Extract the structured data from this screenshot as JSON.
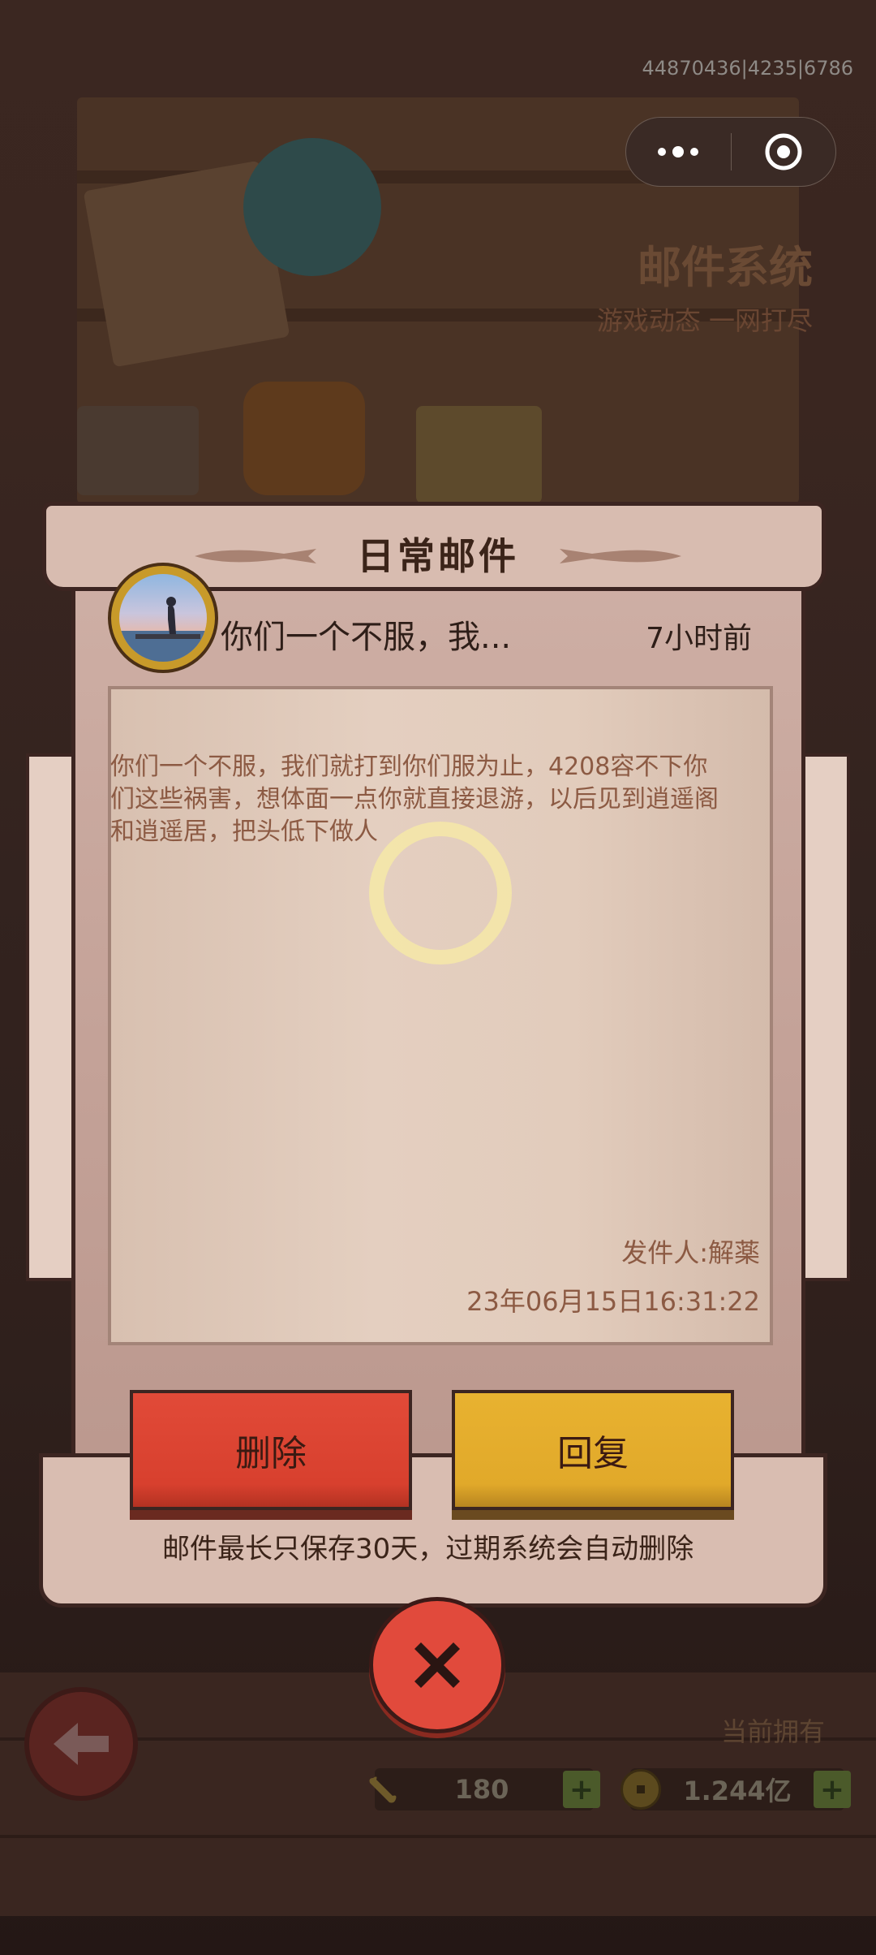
{
  "status": {
    "debug_id": "44870436|4235|6786"
  },
  "capsule": {
    "more_icon": "more-dots-icon",
    "close_icon": "target-circle-icon"
  },
  "background": {
    "title": "邮件系统",
    "subtitle": "游戏动态 一网打尽",
    "owned_label": "当前拥有",
    "resource_1": "180",
    "resource_2": "1.244亿"
  },
  "mail": {
    "title": "日常邮件",
    "subject": "你们一个不服，我...",
    "time_ago": "7小时前",
    "content_lines": [
      "你们一个不服，我们就打到你们服为止，4208容不下你",
      "们这些祸害，想体面一点你就直接退游，以后见到逍遥阁",
      "和逍遥居，把头低下做人"
    ],
    "sender": "发件人:解薬",
    "date": "23年06月15日16:31:22"
  },
  "buttons": {
    "delete": "删除",
    "reply": "回复"
  },
  "notice": "邮件最长只保存30天，过期系统会自动删除",
  "colors": {
    "delete_button": "#e14a38",
    "reply_button": "#e8b230",
    "close_button": "#e14a3c",
    "parchment": "#d9bdb1"
  }
}
